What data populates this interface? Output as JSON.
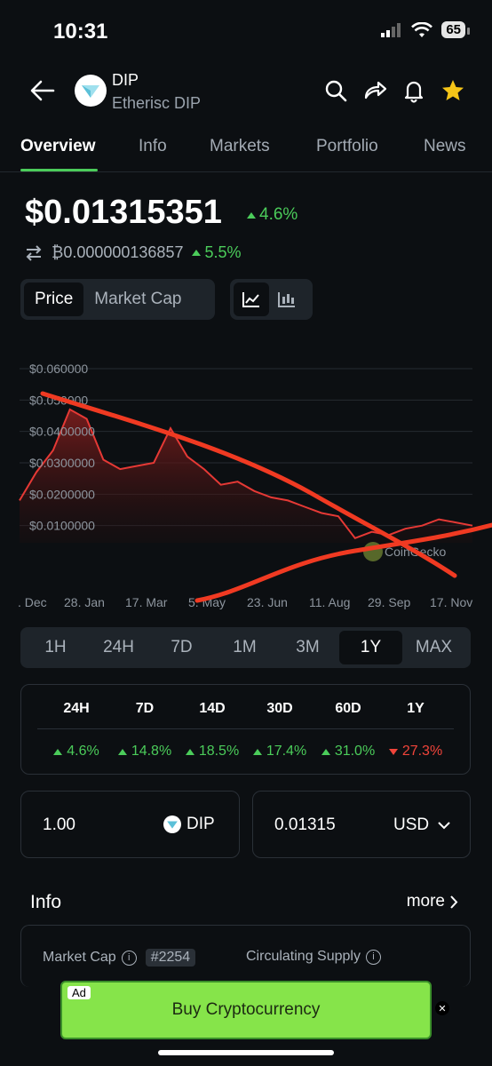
{
  "status": {
    "time": "10:31",
    "battery": "65"
  },
  "coin": {
    "symbol": "DIP",
    "name": "Etherisc DIP"
  },
  "tabs": [
    "Overview",
    "Info",
    "Markets",
    "Portfolio",
    "News"
  ],
  "price": {
    "usd": "$0.01315351",
    "usd_change": "4.6%",
    "btc": "₿0.000000136857",
    "btc_change": "5.5%"
  },
  "chart_toggle": {
    "price": "Price",
    "market_cap": "Market Cap"
  },
  "chart_data": {
    "type": "area",
    "y_ticks": [
      "$0.060000",
      "$0.050000",
      "$0.0400000",
      "$0.0300000",
      "$0.0200000",
      "$0.0100000"
    ],
    "x_ticks": [
      ". Dec",
      "28. Jan",
      "17. Mar",
      "5. May",
      "23. Jun",
      "11. Aug",
      "29. Sep",
      "17. Nov"
    ],
    "ylim": [
      0,
      0.06
    ],
    "values": [
      0.018,
      0.027,
      0.034,
      0.047,
      0.044,
      0.031,
      0.028,
      0.029,
      0.03,
      0.041,
      0.032,
      0.028,
      0.023,
      0.024,
      0.021,
      0.019,
      0.018,
      0.016,
      0.014,
      0.013,
      0.006,
      0.008,
      0.007,
      0.009,
      0.01,
      0.012,
      0.011,
      0.01
    ],
    "watermark": "CoinGecko"
  },
  "ranges": [
    "1H",
    "24H",
    "7D",
    "1M",
    "3M",
    "1Y",
    "MAX"
  ],
  "selected_range": "1Y",
  "performance": [
    {
      "period": "24H",
      "change": "4.6%",
      "dir": "up"
    },
    {
      "period": "7D",
      "change": "14.8%",
      "dir": "up"
    },
    {
      "period": "14D",
      "change": "18.5%",
      "dir": "up"
    },
    {
      "period": "30D",
      "change": "17.4%",
      "dir": "up"
    },
    {
      "period": "60D",
      "change": "31.0%",
      "dir": "up"
    },
    {
      "period": "1Y",
      "change": "27.3%",
      "dir": "down"
    }
  ],
  "converter": {
    "amount": "1.00",
    "coin": "DIP",
    "value": "0.01315",
    "currency": "USD"
  },
  "info": {
    "title": "Info",
    "more": "more",
    "market_cap_label": "Market Cap",
    "rank": "#2254",
    "circ_supply_label": "Circulating Supply"
  },
  "ad": {
    "badge": "Ad",
    "text": "Buy Cryptocurrency"
  },
  "colors": {
    "up": "#4bcc5a",
    "down": "#f0443a",
    "annotation": "#f03a22"
  }
}
